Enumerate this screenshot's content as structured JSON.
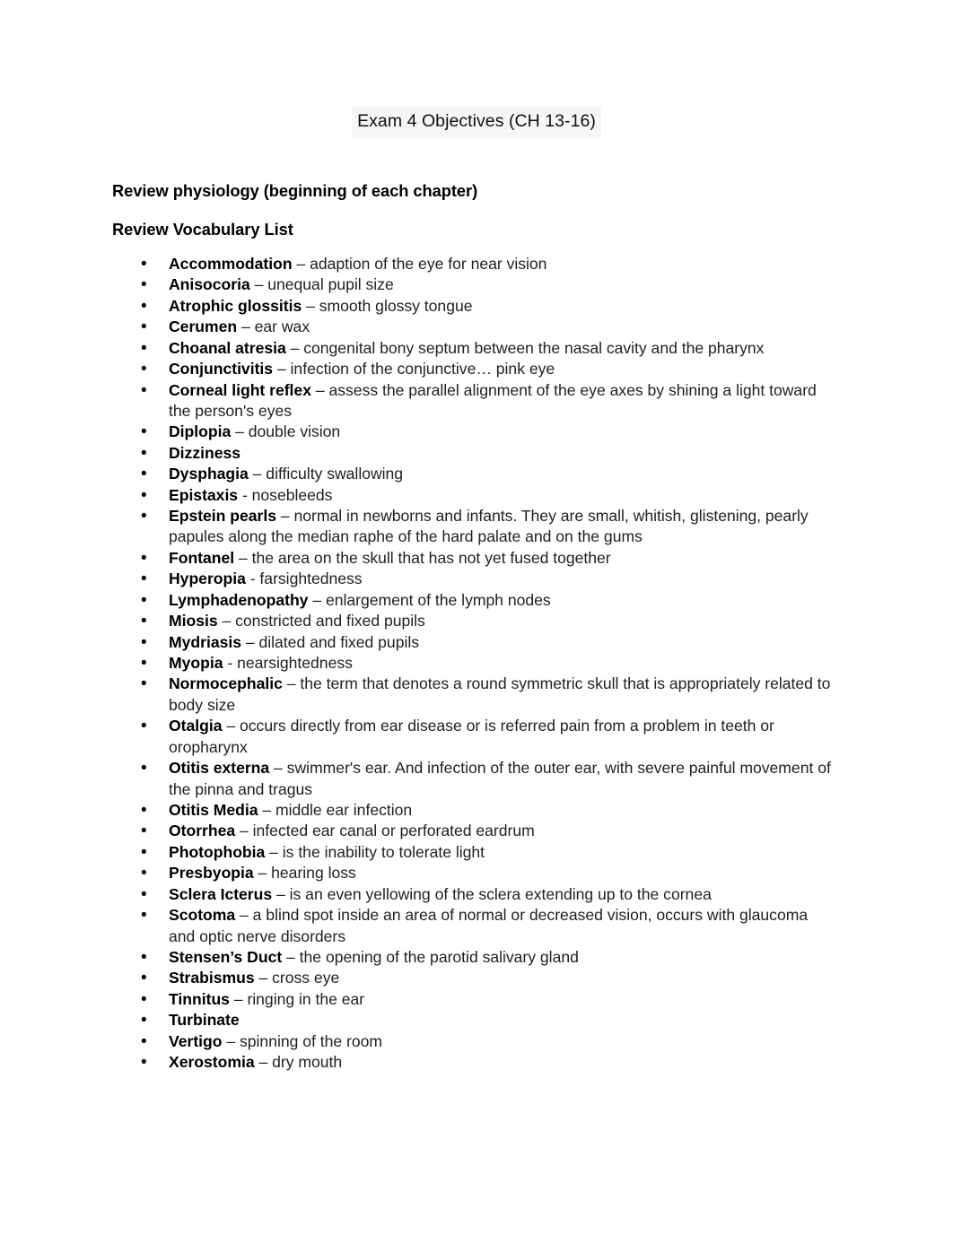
{
  "document": {
    "title": "Exam 4 Objectives (CH 13-16)",
    "title_highlight_color": "#f6f6f6",
    "page_background": "#ffffff",
    "text_color": "#1a1a1a"
  },
  "headings": {
    "physiology": "Review physiology (beginning of each chapter)",
    "vocabulary": "Review Vocabulary List"
  },
  "bullet_glyph": "•",
  "vocabulary_list": [
    {
      "term": "Accommodation",
      "definition": " – adaption of the eye for near vision"
    },
    {
      "term": "Anisocoria",
      "definition": " – unequal pupil size"
    },
    {
      "term": "Atrophic glossitis",
      "definition": " – smooth glossy tongue"
    },
    {
      "term": "Cerumen",
      "definition": " – ear wax"
    },
    {
      "term": "Choanal atresia",
      "definition": " – congenital bony septum between the nasal cavity and the pharynx"
    },
    {
      "term": "Conjunctivitis",
      "definition": " – infection of the conjunctive… pink eye"
    },
    {
      "term": "Corneal light reflex",
      "definition": " – assess the parallel alignment of the eye axes by shining a light toward the person's eyes"
    },
    {
      "term": "Diplopia",
      "definition": " – double vision"
    },
    {
      "term": "Dizziness",
      "definition": ""
    },
    {
      "term": "Dysphagia",
      "definition": " – difficulty swallowing"
    },
    {
      "term": "Epistaxis",
      "definition": " - nosebleeds"
    },
    {
      "term": "Epstein pearls",
      "definition": "  – normal in newborns and infants. They are small, whitish, glistening, pearly papules along the median raphe of the hard palate and on the gums"
    },
    {
      "term": "Fontanel",
      "definition": " – the area on the skull that has not yet fused together"
    },
    {
      "term": "Hyperopia",
      "definition": " - farsightedness"
    },
    {
      "term": "Lymphadenopathy",
      "definition": "  – enlargement of the lymph nodes"
    },
    {
      "term": "Miosis",
      "definition": " – constricted and fixed pupils"
    },
    {
      "term": "Mydriasis",
      "definition": " – dilated and fixed pupils"
    },
    {
      "term": "Myopia",
      "definition": " - nearsightedness"
    },
    {
      "term": "Normocephalic",
      "definition": " – the term that denotes a round symmetric skull that is appropriately related to body size"
    },
    {
      "term": "Otalgia",
      "definition": " – occurs directly from ear disease or is referred pain from a problem in teeth or oropharynx"
    },
    {
      "term": "Otitis externa",
      "definition": " – swimmer's ear. And infection of the outer ear, with severe painful movement of the pinna and tragus"
    },
    {
      "term": "Otitis Media",
      "definition": " – middle ear infection"
    },
    {
      "term": "Otorrhea",
      "definition": "  – infected ear canal or perforated eardrum"
    },
    {
      "term": "Photophobia",
      "definition": " – is the inability to tolerate light"
    },
    {
      "term": "Presbyopia",
      "definition": " – hearing loss"
    },
    {
      "term": "Sclera Icterus",
      "definition": " – is an even yellowing of the sclera extending up to the cornea"
    },
    {
      "term": "Scotoma",
      "definition": " – a blind spot inside an area of normal or decreased vision, occurs with glaucoma and optic nerve disorders"
    },
    {
      "term": "Stensen’s Duct",
      "definition": " – the opening of the parotid salivary gland"
    },
    {
      "term": "Strabismus",
      "definition": " – cross eye"
    },
    {
      "term": "Tinnitus",
      "definition": " – ringing in the ear"
    },
    {
      "term": "Turbinate",
      "definition": ""
    },
    {
      "term": "Vertigo",
      "definition": " – spinning of the room"
    },
    {
      "term": "Xerostomia",
      "definition": " – dry mouth"
    }
  ]
}
